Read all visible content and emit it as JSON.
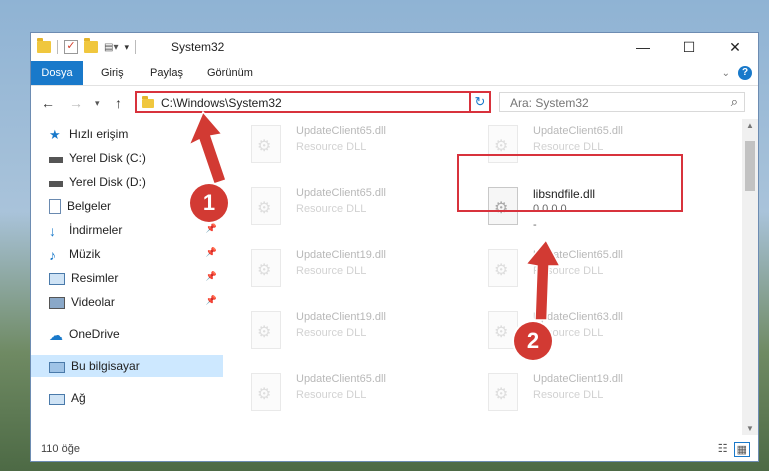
{
  "window": {
    "title": "System32",
    "controls": {
      "minimize": "—",
      "maximize": "☐",
      "close": "✕"
    }
  },
  "ribbon": {
    "tabs": [
      {
        "label": "Dosya"
      },
      {
        "label": "Giriş"
      },
      {
        "label": "Paylaş"
      },
      {
        "label": "Görünüm"
      }
    ],
    "help": "?"
  },
  "address": {
    "path": "C:\\Windows\\System32"
  },
  "search": {
    "placeholder": "Ara: System32"
  },
  "sidebar": {
    "items": [
      {
        "label": "Hızlı erişim"
      },
      {
        "label": "Yerel Disk (C:)"
      },
      {
        "label": "Yerel Disk (D:)"
      },
      {
        "label": "Belgeler"
      },
      {
        "label": "İndirmeler"
      },
      {
        "label": "Müzik"
      },
      {
        "label": "Resimler"
      },
      {
        "label": "Videolar"
      },
      {
        "label": "OneDrive"
      },
      {
        "label": "Bu bilgisayar"
      },
      {
        "label": "Ağ"
      }
    ]
  },
  "files": [
    {
      "name": "UpdateClient65.dll",
      "desc": "Resource DLL"
    },
    {
      "name": "UpdateClient65.dll",
      "desc": "Resource DLL"
    },
    {
      "name": "UpdateClient65.dll",
      "desc": "Resource DLL"
    },
    {
      "name": "libsndfile.dll",
      "desc": "0.0.0.0",
      "desc2": "-"
    },
    {
      "name": "UpdateClient19.dll",
      "desc": "Resource DLL"
    },
    {
      "name": "UpdateClient65.dll",
      "desc": "Resource DLL"
    },
    {
      "name": "UpdateClient19.dll",
      "desc": "Resource DLL"
    },
    {
      "name": "UpdateClient63.dll",
      "desc": "Resource DLL"
    },
    {
      "name": "UpdateClient65.dll",
      "desc": "Resource DLL"
    },
    {
      "name": "UpdateClient19.dll",
      "desc": "Resource DLL"
    }
  ],
  "status": {
    "count": "110 öğe"
  },
  "markers": {
    "one": "1",
    "two": "2"
  },
  "colors": {
    "accent": "#1979ca",
    "highlight": "#d8323c",
    "marker": "#d23a33"
  }
}
